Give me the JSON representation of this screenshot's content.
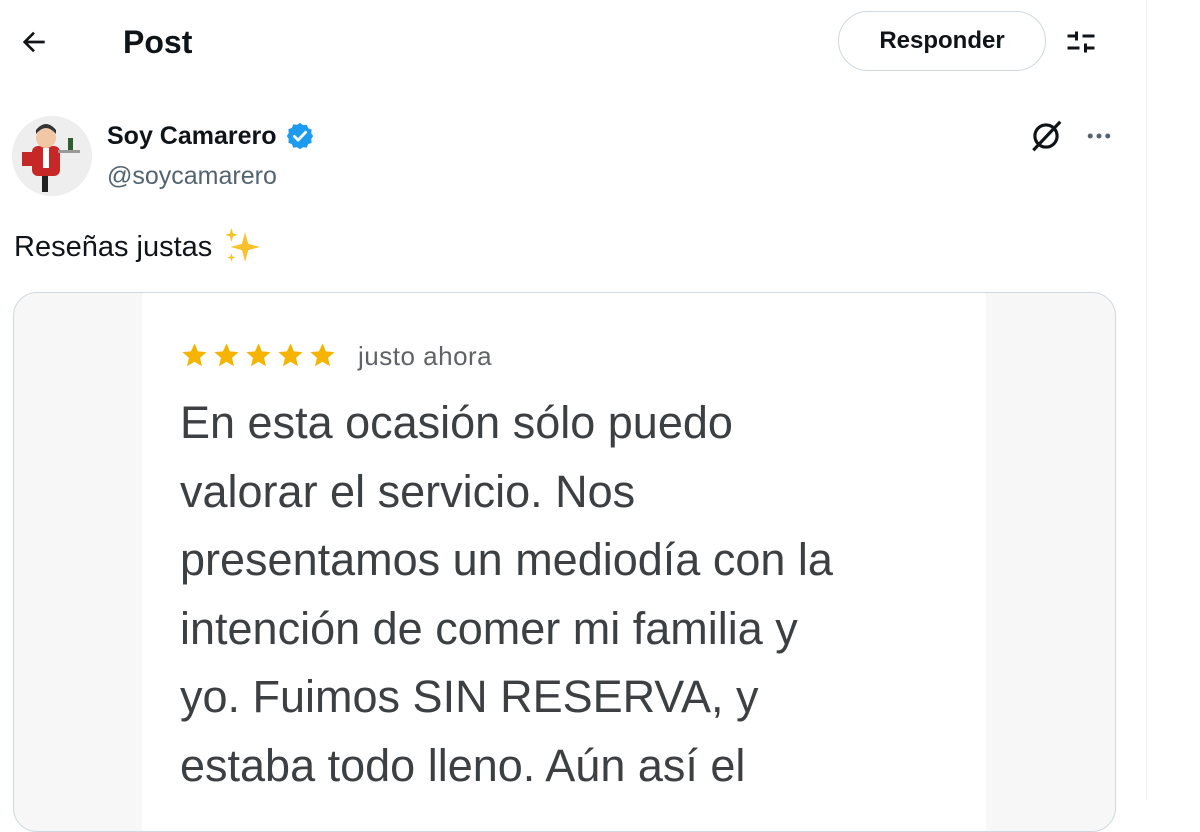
{
  "header": {
    "title": "Post",
    "reply_label": "Responder"
  },
  "author": {
    "name": "Soy Camarero",
    "handle": "@soycamarero",
    "verified": true
  },
  "post": {
    "text": "Reseñas justas",
    "emoji": "sparkles"
  },
  "media": {
    "review": {
      "stars": 5,
      "time": "justo ahora",
      "lines": [
        "En esta ocasión sólo puedo",
        "valorar el servicio. Nos",
        "presentamos un mediodía con la",
        "intención de comer mi familia y",
        "yo. Fuimos SIN RESERVA, y",
        "estaba todo lleno. Aún así el"
      ]
    }
  },
  "colors": {
    "accent_verified": "#1d9bf0",
    "star": "#f4b400",
    "text_primary": "#0f1419",
    "text_secondary": "#536471"
  },
  "icons": {
    "back": "arrow-left-icon",
    "settings": "sliders-icon",
    "verified": "verified-badge-icon",
    "grok": "grok-icon",
    "more": "more-icon",
    "sparkles": "sparkles-icon",
    "star": "star-icon"
  }
}
